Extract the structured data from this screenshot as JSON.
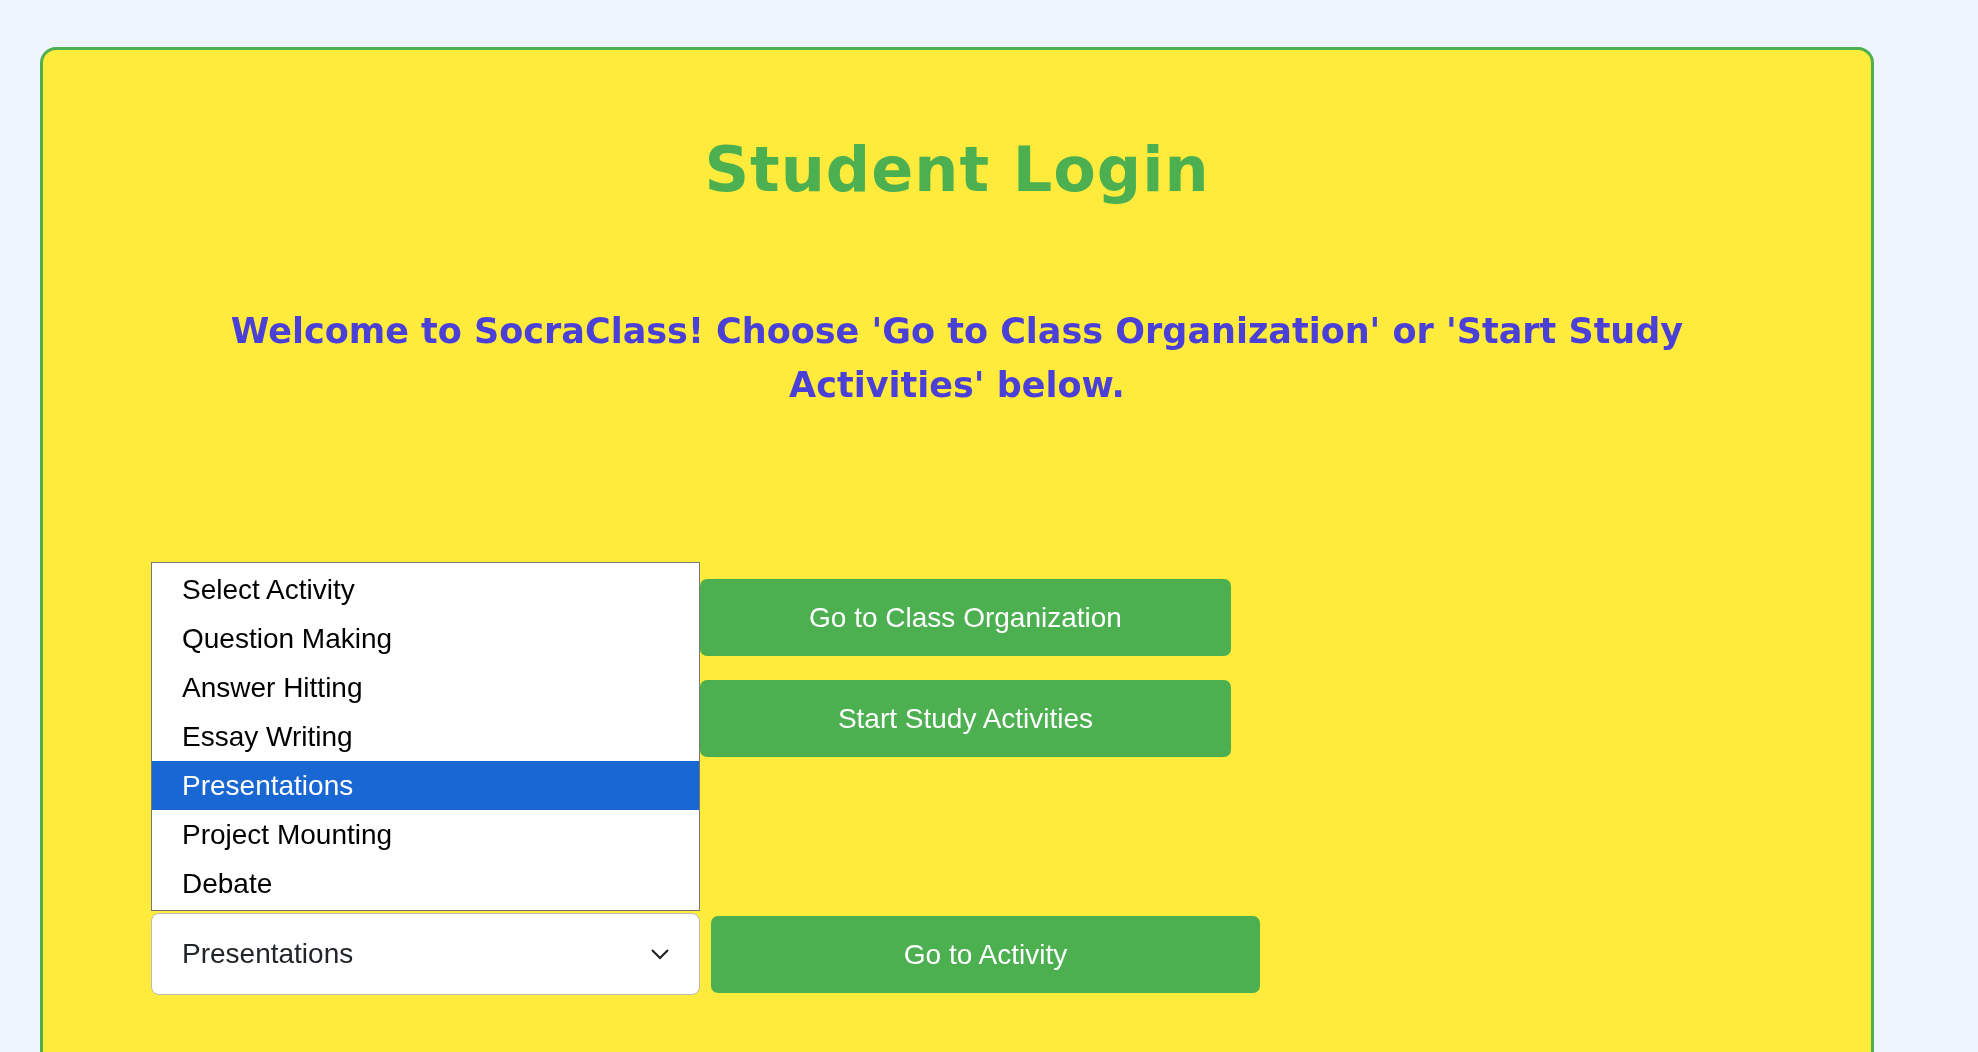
{
  "title": "Student Login",
  "welcome": "Welcome to SocraClass! Choose 'Go to Class Organization' or 'Start Study Activities' below.",
  "buttons": [
    "Go to Class Organization",
    "Start Study Activities"
  ],
  "activity_select": {
    "value": "Presentations",
    "expanded": true,
    "options": [
      {
        "label": "Select Activity",
        "selected": false
      },
      {
        "label": "Question Making",
        "selected": false
      },
      {
        "label": "Answer Hitting",
        "selected": false
      },
      {
        "label": "Essay Writing",
        "selected": false
      },
      {
        "label": "Presentations",
        "selected": true
      },
      {
        "label": "Project Mounting",
        "selected": false
      },
      {
        "label": "Debate",
        "selected": false
      }
    ]
  },
  "activity_button": "Go to Activity"
}
